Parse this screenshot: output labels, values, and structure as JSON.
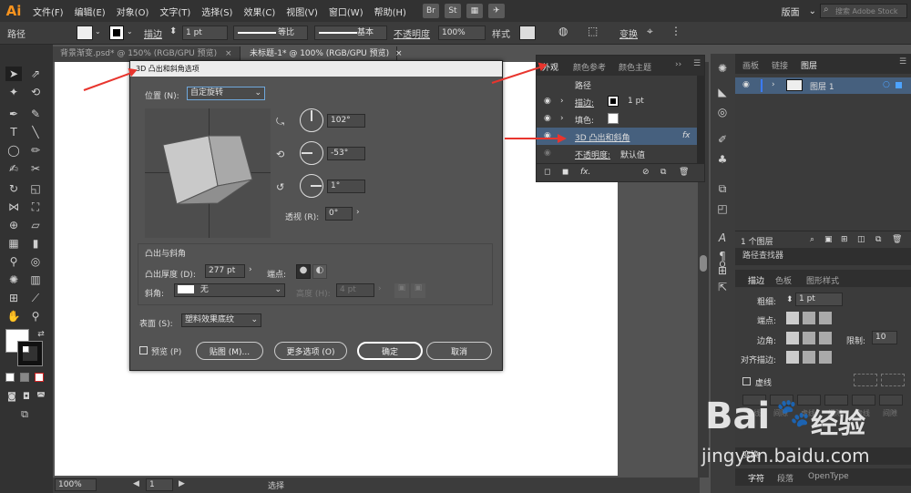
{
  "app": {
    "logo": "Ai"
  },
  "menu": [
    "文件(F)",
    "编辑(E)",
    "对象(O)",
    "文字(T)",
    "选择(S)",
    "效果(C)",
    "视图(V)",
    "窗口(W)",
    "帮助(H)"
  ],
  "menu_right": {
    "br": "Br",
    "st": "St",
    "workspace": "版面",
    "search_placeholder": "搜索 Adobe Stock"
  },
  "control_bar": {
    "object_type": "路径",
    "stroke_label": "描边",
    "stroke_value": "1 pt",
    "profile_label": "等比",
    "brush_label": "基本",
    "opacity_label": "不透明度",
    "opacity_value": "100%",
    "style_label": "样式",
    "transform_label": "变换"
  },
  "doc_tabs": [
    {
      "label": "背景渐变.psd* @ 150% (RGB/GPU 预览)",
      "close": "×"
    },
    {
      "label": "未标题-1* @ 100% (RGB/GPU 预览)",
      "close": "×"
    }
  ],
  "status": {
    "zoom": "100%",
    "page": "1",
    "mode": "选择"
  },
  "dialog": {
    "title": "3D 凸出和斜角选项",
    "position_label": "位置 (N):",
    "position_value": "自定旋转",
    "rot_x": "102°",
    "rot_y": "-53°",
    "rot_z": "1°",
    "perspective_label": "透视 (R):",
    "perspective_value": "0°",
    "extrude_section": "凸出与斜角",
    "depth_label": "凸出厚度 (D):",
    "depth_value": "277 pt",
    "cap_label": "端点:",
    "bevel_label": "斜角:",
    "bevel_value": "无",
    "height_label": "高度 (H):",
    "height_value": "4 pt",
    "surface_label": "表面 (S):",
    "surface_value": "塑料效果底纹",
    "preview_label": "预览 (P)",
    "map_button": "贴图 (M)...",
    "more_button": "更多选项 (O)",
    "ok_button": "确定",
    "cancel_button": "取消"
  },
  "appearance": {
    "tabs": [
      "外观",
      "颜色参考",
      "颜色主题"
    ],
    "header": "路径",
    "stroke_label": "描边:",
    "stroke_value": "1 pt",
    "fill_label": "填色:",
    "effect_label": "3D 凸出和斜角",
    "effect_fx": "fx",
    "opacity_label": "不透明度:",
    "opacity_value": "默认值",
    "fx_button": "fx."
  },
  "layers": {
    "tabs": [
      "画板",
      "链接",
      "图层"
    ],
    "layer_name": "图层 1",
    "footer": "1 个图层"
  },
  "pathfinder": {
    "title": "路径查找器"
  },
  "stroke_panel": {
    "tabs": [
      "描边",
      "色板",
      "图形样式"
    ],
    "weight_label": "粗细:",
    "weight_value": "1 pt",
    "cap_label": "端点:",
    "corner_label": "边角:",
    "limit_label": "限制:",
    "limit_value": "10",
    "align_label": "对齐描边:",
    "dashed_label": "虚线",
    "dash_labels": [
      "虚线",
      "间隙",
      "虚线",
      "间隙",
      "虚线",
      "间隙"
    ]
  },
  "bottom_panels": {
    "transform": "变换",
    "char_tabs": [
      "字符",
      "段落",
      "OpenType"
    ]
  },
  "watermark": {
    "brand": "Bai",
    "brand2": "经验",
    "url": "jingyan.baidu.com"
  },
  "colors": {
    "arrow": "#e8352e",
    "accent": "#f7931e",
    "selection": "#46607e"
  }
}
